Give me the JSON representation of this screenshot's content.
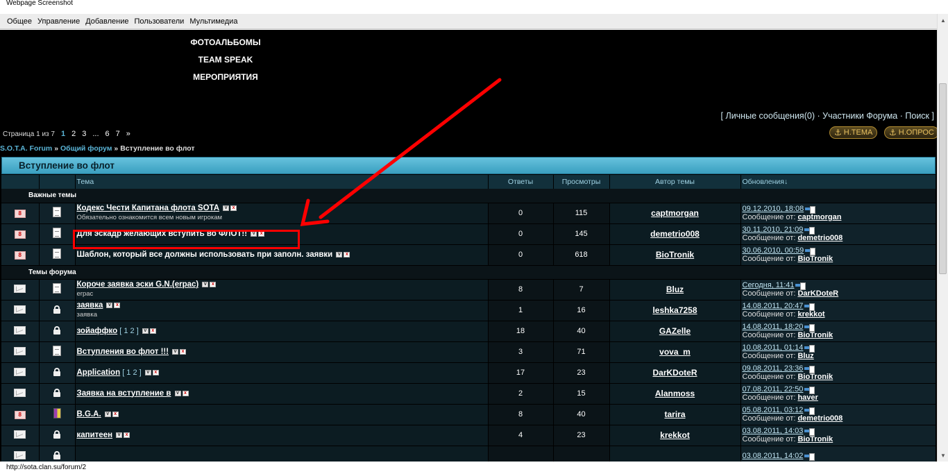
{
  "window": {
    "title": "Webpage Screenshot",
    "status_url": "http://sota.clan.su/forum/2"
  },
  "menu": [
    "Общее",
    "Управление",
    "Добавление",
    "Пользователи",
    "Мультимедиа"
  ],
  "banner_links": [
    "ФОТОАЛЬБОМЫ",
    "TEAM SPEAK",
    "МЕРОПРИЯТИЯ"
  ],
  "topnav": {
    "open": "[",
    "messages": "Личные сообщения(0)",
    "sep1": "·",
    "members": "Участники Форума",
    "sep2": "·",
    "search": "Поиск",
    "close": "]"
  },
  "pager": {
    "label": "Страница 1 из 7",
    "items": [
      "1",
      "2",
      "3",
      "...",
      "6",
      "7",
      "»"
    ],
    "current": "1"
  },
  "buttons": {
    "new_topic": "Н.ТЕМА",
    "new_poll": "Н.ОПРОС"
  },
  "breadcrumb": {
    "root": "S.O.T.A. Forum",
    "sep1": "»",
    "forum": "Общий форум",
    "sep2": "»",
    "current": "Вступление во флот"
  },
  "forum_title": "Вступление во флот",
  "columns": {
    "topic": "Тема",
    "replies": "Ответы",
    "views": "Просмотры",
    "author": "Автор темы",
    "updates": "Обновления↓"
  },
  "sections": {
    "important": "Важные темы",
    "forum": "Темы форума"
  },
  "last_by_label": "Сообщение от:",
  "important_topics": [
    {
      "icon": "pin",
      "type": "doc",
      "title": "Кодекс Чести Капитана флота SOTA",
      "desc": "Обязательно ознакомится всем новым игрокам",
      "pages": "",
      "replies": "0",
      "views": "115",
      "author": "captmorgan",
      "date": "09.12.2010, 18:08",
      "last_by": "captmorgan"
    },
    {
      "icon": "pin",
      "type": "doc",
      "title": "Для эскадр желающих вступить во ФЛОТ!!",
      "desc": "",
      "pages": "",
      "replies": "0",
      "views": "145",
      "author": "demetrio008",
      "date": "30.11.2010, 21:09",
      "last_by": "demetrio008"
    },
    {
      "icon": "pin",
      "type": "doc",
      "title": "Шаблон, который все должны использовать при заполн. заявки",
      "desc": "",
      "pages": "",
      "replies": "0",
      "views": "618",
      "author": "BioTronik",
      "date": "30.06.2010, 00:59",
      "last_by": "BioTronik"
    }
  ],
  "forum_topics": [
    {
      "icon": "env",
      "type": "doc",
      "title": "Короче заявка эски G.N.(erpac)",
      "desc": "erpac",
      "pages": "",
      "replies": "8",
      "views": "7",
      "author": "Bluz",
      "date": "Сегодня, 11:41",
      "last_by": "DarKDoteR"
    },
    {
      "icon": "env",
      "type": "lock",
      "title": "заявка",
      "desc": "заявка",
      "pages": "",
      "replies": "1",
      "views": "16",
      "author": "leshka7258",
      "date": "14.08.2011, 20:47",
      "last_by": "krekkot"
    },
    {
      "icon": "env",
      "type": "lock",
      "title": "зойаффко",
      "desc": "",
      "pages": "[ 1 2 ]",
      "replies": "18",
      "views": "40",
      "author": "GAZelle",
      "date": "14.08.2011, 18:20",
      "last_by": "BioTronik"
    },
    {
      "icon": "env",
      "type": "doc",
      "title": "Вступления во флот !!!",
      "desc": "",
      "pages": "",
      "replies": "3",
      "views": "71",
      "author": "vova_m",
      "date": "10.08.2011, 01:14",
      "last_by": "Bluz"
    },
    {
      "icon": "env",
      "type": "lock",
      "title": "Application",
      "desc": "",
      "pages": "[ 1 2 ]",
      "replies": "17",
      "views": "23",
      "author": "DarKDoteR",
      "date": "09.08.2011, 23:36",
      "last_by": "BioTronik"
    },
    {
      "icon": "env",
      "type": "lock",
      "title": "Заявка на вступление в",
      "desc": "",
      "pages": "",
      "replies": "2",
      "views": "15",
      "author": "Alanmoss",
      "date": "07.08.2011, 22:50",
      "last_by": "haver"
    },
    {
      "icon": "pin",
      "type": "book",
      "title": "B.G.A.",
      "desc": "",
      "pages": "",
      "replies": "8",
      "views": "40",
      "author": "tarira",
      "date": "05.08.2011, 03:12",
      "last_by": "demetrio008"
    },
    {
      "icon": "env",
      "type": "lock",
      "title": "капитеен",
      "desc": "",
      "pages": "",
      "replies": "4",
      "views": "23",
      "author": "krekkot",
      "date": "03.08.2011, 14:03",
      "last_by": "BioTronik"
    },
    {
      "icon": "env",
      "type": "lock",
      "title": "",
      "desc": "",
      "pages": "",
      "replies": "",
      "views": "",
      "author": "",
      "date": "03.08.2011, 14:02",
      "last_by": ""
    }
  ],
  "colors": {
    "accent": "#5ab4d6",
    "header_bar": "#3a9fbf",
    "annotation": "#ff0000"
  }
}
